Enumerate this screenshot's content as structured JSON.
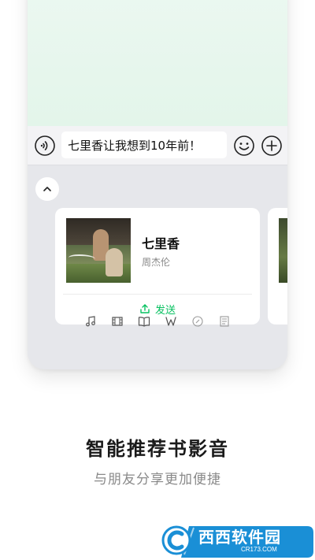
{
  "input": {
    "value": "七里香让我想到10年前！"
  },
  "card": {
    "title": "七里香",
    "artist": "周杰伦",
    "send_label": "发送"
  },
  "tabs": [
    {
      "icon": "music-note-icon"
    },
    {
      "icon": "film-icon"
    },
    {
      "icon": "book-icon"
    },
    {
      "icon": "w-logo-icon"
    },
    {
      "icon": "link-icon"
    },
    {
      "icon": "document-icon"
    }
  ],
  "promo": {
    "headline": "智能推荐书影音",
    "subline": "与朋友分享更加便捷"
  },
  "watermark": {
    "text": "西西软件园",
    "sub": "CR173.COM"
  },
  "colors": {
    "accent": "#07c160",
    "chat_bg": "#e3f5ea",
    "panel_bg": "#e6e7eb"
  }
}
